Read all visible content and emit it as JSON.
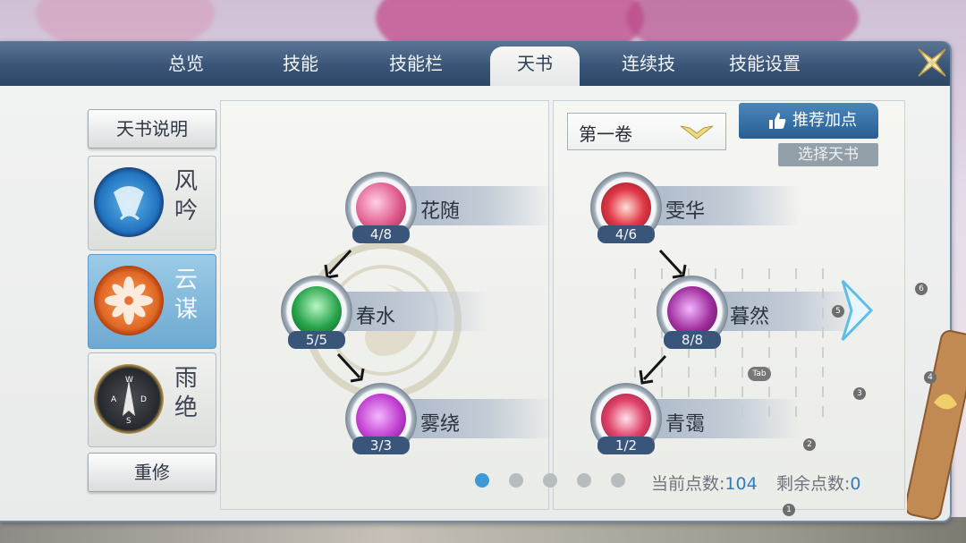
{
  "tabs": [
    {
      "label": "总览"
    },
    {
      "label": "技能"
    },
    {
      "label": "技能栏"
    },
    {
      "label": "天书",
      "active": true
    },
    {
      "label": "连续技"
    },
    {
      "label": "技能设置"
    }
  ],
  "close_icon": "close-x-icon",
  "left": {
    "explain_label": "天书说明",
    "books": [
      {
        "name": "风吟",
        "icon": "fan-emblem-icon",
        "active": false
      },
      {
        "name": "云谋",
        "icon": "lotus-emblem-icon",
        "active": true
      },
      {
        "name": "雨绝",
        "icon": "compass-emblem-icon",
        "active": false
      }
    ],
    "reset_label": "重修"
  },
  "tree_left": {
    "nodes": [
      {
        "name": "花随",
        "count": "4/8",
        "color": "#e05a8e"
      },
      {
        "name": "春水",
        "count": "5/5",
        "color": "#27a24a"
      },
      {
        "name": "雾绕",
        "count": "3/3",
        "color": "#c13fd0"
      }
    ]
  },
  "tree_right": {
    "volume_label": "第一卷",
    "recommend_label": "推荐加点",
    "select_label": "选择天书",
    "nodes": [
      {
        "name": "雯华",
        "count": "4/6",
        "color": "#e23a48"
      },
      {
        "name": "暮然",
        "count": "8/8",
        "color": "#a02f9e"
      },
      {
        "name": "青霭",
        "count": "1/2",
        "color": "#e0436a"
      }
    ]
  },
  "pagination": {
    "total": 5,
    "current": 1
  },
  "points": {
    "current_label": "当前点数:",
    "current_value": "104",
    "remaining_label": "剩余点数:",
    "remaining_value": "0"
  },
  "overlay_badges": [
    "1",
    "2",
    "3",
    "4",
    "5",
    "6"
  ],
  "tab_hint": "Tab"
}
